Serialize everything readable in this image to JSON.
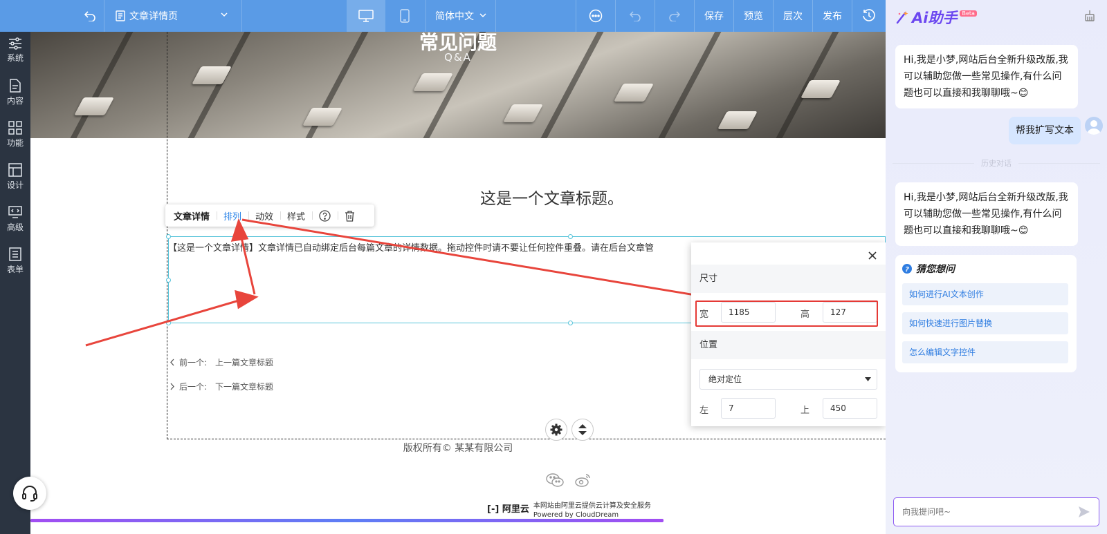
{
  "toolbar": {
    "page_name": "文章详情页",
    "language": "简体中文",
    "save": "保存",
    "preview": "预览",
    "layers": "层次",
    "publish": "发布"
  },
  "sidebar": {
    "items": [
      {
        "label": "系统",
        "icon": "sliders-icon"
      },
      {
        "label": "内容",
        "icon": "document-icon"
      },
      {
        "label": "功能",
        "icon": "grid-icon"
      },
      {
        "label": "设计",
        "icon": "layout-icon"
      },
      {
        "label": "高级",
        "icon": "code-monitor-icon"
      },
      {
        "label": "表单",
        "icon": "form-list-icon"
      }
    ]
  },
  "canvas": {
    "banner_title": "常见问题",
    "banner_subtitle": "Q&A",
    "article_title": "这是一个文章标题。",
    "body_text": "【这是一个文章详情】文章详情已自动绑定后台每篇文章的详情数据。拖动控件时请不要让任何控件重叠。请在后台文章管",
    "prev_label": "前一个:",
    "prev_title": "上一篇文章标题",
    "next_label": "后一个:",
    "next_title": "下一篇文章标题",
    "copyright": "版权所有© 某某有限公司",
    "aliyun_logo": "阿里云",
    "aliyun_line1": "本网站由阿里云提供云计算及安全服务",
    "aliyun_line2": "Powered by CloudDream",
    "progress_percent": 74
  },
  "mini_toolbar": {
    "items": [
      "文章详情",
      "排列",
      "动效",
      "样式"
    ],
    "active_index": 1
  },
  "props": {
    "size_title": "尺寸",
    "width_label": "宽",
    "width_value": "1185",
    "height_label": "高",
    "height_value": "127",
    "position_title": "位置",
    "position_mode": "绝对定位",
    "left_label": "左",
    "left_value": "7",
    "top_label": "上",
    "top_value": "450"
  },
  "ai": {
    "title": "Ai助手",
    "beta": "Beta",
    "greeting1": "Hi,我是小梦,网站后台全新升级改版,我可以辅助您做一些常见操作,有什么问题也可以直接和我聊聊哦~😊",
    "user_msg": "帮我扩写文本",
    "history_label": "历史对话",
    "greeting2": "Hi,我是小梦,网站后台全新升级改版,我可以辅助您做一些常见操作,有什么问题也可以直接和我聊聊哦~😊",
    "guess_title": "猜您想问",
    "guesses": [
      "如何进行AI文本创作",
      "如何快速进行图片替换",
      "怎么编辑文字控件"
    ],
    "input_placeholder": "向我提问吧~"
  },
  "colors": {
    "toolbar": "#5a9be6",
    "sidebar": "#2b3441",
    "accent": "#2f86e8",
    "highlight": "#e53935",
    "ai_accent": "#6b47f0"
  }
}
